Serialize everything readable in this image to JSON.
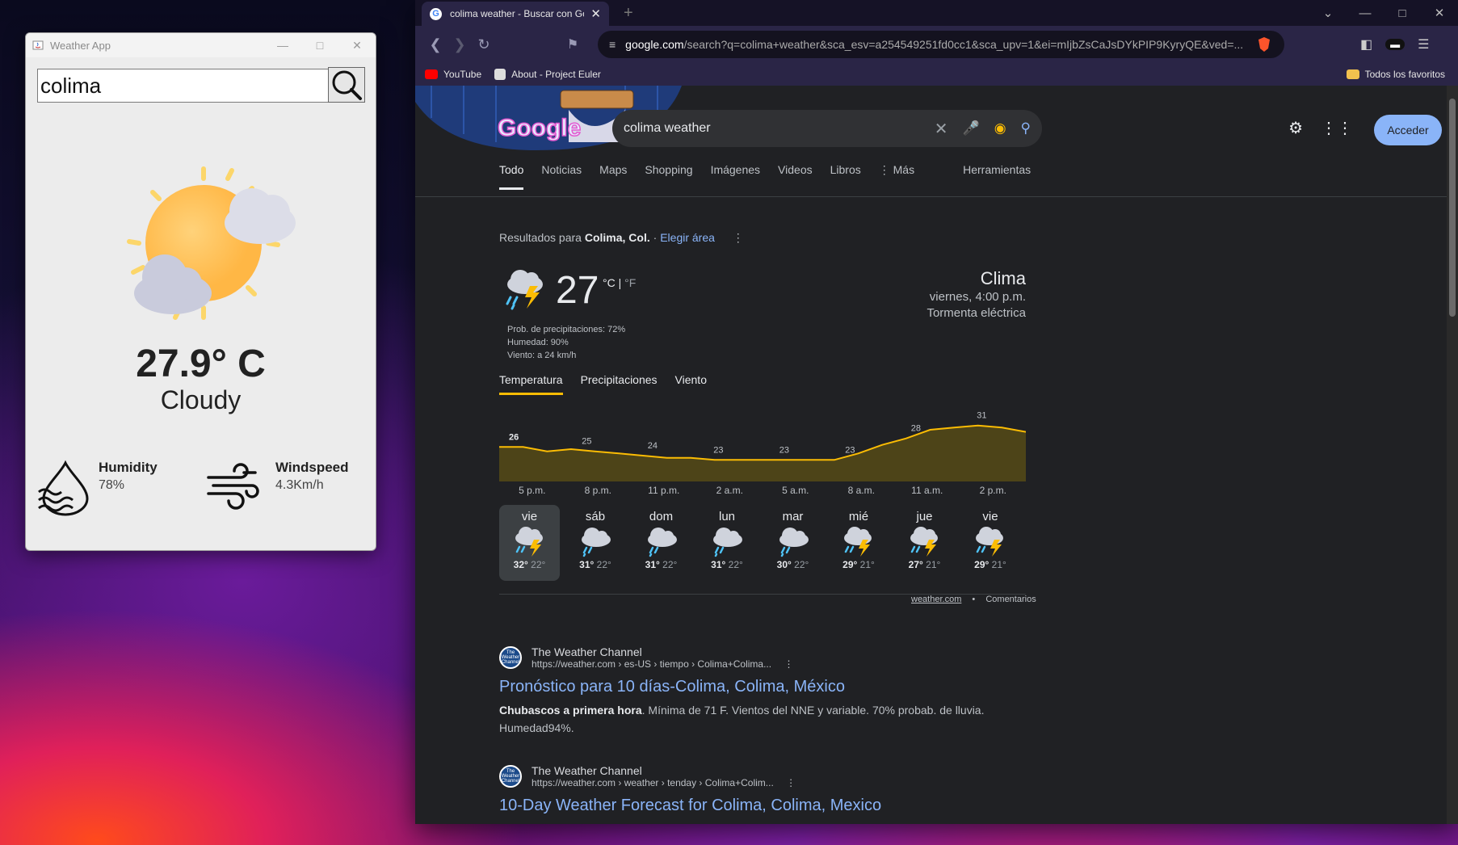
{
  "weather_app": {
    "window_title": "Weather App",
    "search_value": "colima",
    "temperature": "27.9° C",
    "condition": "Cloudy",
    "humidity_label": "Humidity",
    "humidity_value": "78%",
    "wind_label": "Windspeed",
    "wind_value": "4.3Km/h"
  },
  "browser": {
    "tab_title": "colima weather - Buscar con Google",
    "url_domain": "google.com",
    "url_rest": "/search?q=colima+weather&sca_esv=a254549251fd0cc1&sca_upv=1&ei=mIjbZsCaJsDYkPIP9KyryQE&ved=...",
    "bookmarks": [
      "YouTube",
      "About - Project Euler"
    ],
    "bookmarks_right": "Todos los favoritos"
  },
  "google": {
    "query": "colima weather",
    "sign_in": "Acceder",
    "tabs": [
      "Todo",
      "Noticias",
      "Maps",
      "Shopping",
      "Imágenes",
      "Videos",
      "Libros",
      "⋮ Más"
    ],
    "tools": "Herramientas",
    "results_for_prefix": "Resultados para",
    "results_for_place": "Colima, Col.",
    "choose_area": "Elegir área",
    "weather": {
      "temp": "27",
      "unit_c": "°C",
      "unit_f": "°F",
      "precip": "Prob. de precipitaciones: 72%",
      "humidity": "Humedad: 90%",
      "wind": "Viento: a 24 km/h",
      "heading": "Clima",
      "time": "viernes, 4:00 p.m.",
      "condition": "Tormenta eléctrica",
      "subtabs": [
        "Temperatura",
        "Precipitaciones",
        "Viento"
      ],
      "source": "weather.com",
      "feedback": "Comentarios"
    },
    "results": [
      {
        "site": "The Weather Channel",
        "url": "https://weather.com › es-US › tiempo › Colima+Colima...",
        "title": "Pronóstico para 10 días-Colima, Colima, México",
        "snippet_bold": "Chubascos a primera hora",
        "snippet": ". Mínima de 71 F. Vientos del NNE y variable. 70% probab. de lluvia. Humedad94%."
      },
      {
        "site": "The Weather Channel",
        "url": "https://weather.com › weather › tenday › Colima+Colim...",
        "title": "10-Day Weather Forecast for Colima, Colima, Mexico"
      }
    ]
  },
  "chart_data": {
    "type": "area",
    "x": [
      "5 p.m.",
      "8 p.m.",
      "11 p.m.",
      "2 a.m.",
      "5 a.m.",
      "8 a.m.",
      "11 a.m.",
      "2 p.m."
    ],
    "label_points": [
      26,
      25,
      24,
      23,
      23,
      23,
      28,
      31
    ],
    "series": [
      {
        "values": [
          26,
          26,
          25,
          25.5,
          25,
          24.5,
          24,
          23.5,
          23.5,
          23,
          23,
          23,
          23,
          23,
          23,
          24.5,
          26.5,
          28,
          30,
          30.5,
          31,
          30.5,
          29.5
        ]
      }
    ],
    "ylim": [
      18,
      33
    ],
    "line_color": "#fbbc04",
    "fill_color": "#4d4418"
  },
  "forecast": [
    {
      "day": "vie",
      "hi": "32°",
      "lo": "22°",
      "icon": "storm-icon"
    },
    {
      "day": "sáb",
      "hi": "31°",
      "lo": "22°",
      "icon": "cloud-rain-icon"
    },
    {
      "day": "dom",
      "hi": "31°",
      "lo": "22°",
      "icon": "cloud-rain-icon"
    },
    {
      "day": "lun",
      "hi": "31°",
      "lo": "22°",
      "icon": "cloud-rain-icon"
    },
    {
      "day": "mar",
      "hi": "30°",
      "lo": "22°",
      "icon": "cloud-rain-icon"
    },
    {
      "day": "mié",
      "hi": "29°",
      "lo": "21°",
      "icon": "storm-icon"
    },
    {
      "day": "jue",
      "hi": "27°",
      "lo": "21°",
      "icon": "storm-icon"
    },
    {
      "day": "vie",
      "hi": "29°",
      "lo": "21°",
      "icon": "storm-icon"
    }
  ]
}
